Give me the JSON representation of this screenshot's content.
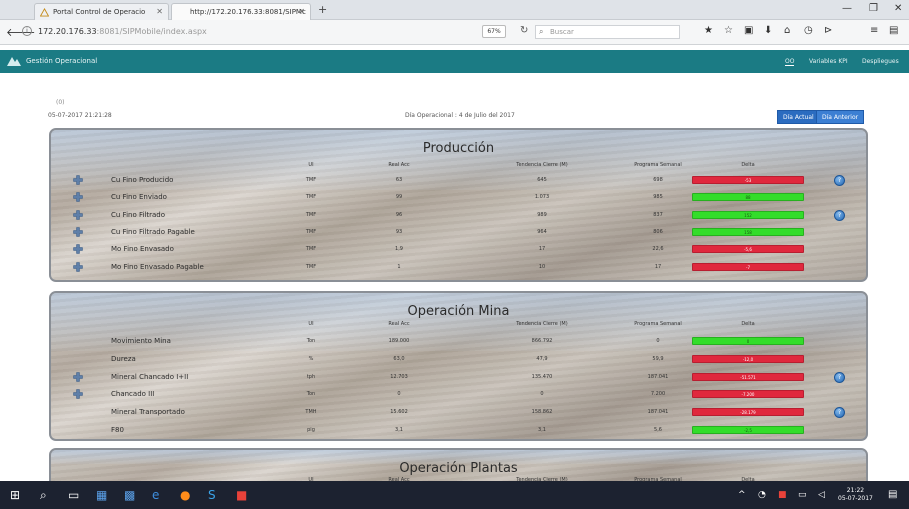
{
  "browser": {
    "tabs": [
      {
        "label": "Portal Control de Operacio",
        "active": false
      },
      {
        "label": "http://172.20.176.33:8081/SIPMc",
        "active": true
      }
    ],
    "url_host": "172.20.176.33",
    "url_rest": ":8081/SIPMobile/index.aspx",
    "zoom": "67%",
    "search_placeholder": "Buscar"
  },
  "app": {
    "title": "Gestión Operacional",
    "nav": [
      "OO",
      "Variables KPI",
      "Despliegues"
    ]
  },
  "meta": {
    "small": "(0)",
    "date": "05-07-2017 21:21:28",
    "center": "Día Operacional : 4 de Julio del 2017",
    "btn_actual": "Día Actual",
    "btn_anterior": "Día Anterior"
  },
  "columns": {
    "ui": "UI",
    "real": "Real Acc",
    "tendencia": "Tendencia Cierre (M)",
    "programa": "Programa Semanal",
    "delta": "Delta"
  },
  "colors": {
    "header": "#1b7b84",
    "delta_red": "#e0283d",
    "delta_green": "#33dd2a",
    "button_blue": "#2b6cc0"
  },
  "panels": [
    {
      "title": "Producción",
      "rows": [
        {
          "label": "Cu Fino Producido",
          "ui": "TMF",
          "real": "63",
          "tendencia": "645",
          "programa": "698",
          "delta": "-53",
          "status": "red",
          "icon": true,
          "info": true
        },
        {
          "label": "Cu Fino Enviado",
          "ui": "TMF",
          "real": "99",
          "tendencia": "1.073",
          "programa": "985",
          "delta": "88",
          "status": "green",
          "icon": true,
          "info": false
        },
        {
          "label": "Cu Fino Filtrado",
          "ui": "TMF",
          "real": "96",
          "tendencia": "989",
          "programa": "837",
          "delta": "152",
          "status": "green",
          "icon": true,
          "info": true
        },
        {
          "label": "Cu Fino Filtrado Pagable",
          "ui": "TMF",
          "real": "93",
          "tendencia": "964",
          "programa": "806",
          "delta": "158",
          "status": "green",
          "icon": true,
          "info": false
        },
        {
          "label": "Mo Fino Envasado",
          "ui": "TMF",
          "real": "1,9",
          "tendencia": "17",
          "programa": "22,6",
          "delta": "-5,6",
          "status": "red",
          "icon": true,
          "info": false
        },
        {
          "label": "Mo Fino Envasado Pagable",
          "ui": "TMF",
          "real": "1",
          "tendencia": "10",
          "programa": "17",
          "delta": "-7",
          "status": "red",
          "icon": true,
          "info": false
        }
      ]
    },
    {
      "title": "Operación Mina",
      "rows": [
        {
          "label": "Movimiento Mina",
          "ui": "Ton",
          "real": "189.000",
          "tendencia": "866.792",
          "programa": "0",
          "delta": "0",
          "status": "green",
          "icon": false,
          "info": false
        },
        {
          "label": "Dureza",
          "ui": "%",
          "real": "63,0",
          "tendencia": "47,9",
          "programa": "59,9",
          "delta": "-12,0",
          "status": "red",
          "icon": false,
          "info": false
        },
        {
          "label": "Mineral Chancado I+II",
          "ui": "tph",
          "real": "12.703",
          "tendencia": "135.470",
          "programa": "187.041",
          "delta": "-51.571",
          "status": "red",
          "icon": true,
          "info": true
        },
        {
          "label": "Chancado III",
          "ui": "Ton",
          "real": "0",
          "tendencia": "0",
          "programa": "7.200",
          "delta": "-7.200",
          "status": "red",
          "icon": true,
          "info": false
        },
        {
          "label": "Mineral Transportado",
          "ui": "TMH",
          "real": "15.602",
          "tendencia": "158.862",
          "programa": "187.041",
          "delta": "-28.179",
          "status": "red",
          "icon": false,
          "info": true
        },
        {
          "label": "F80",
          "ui": "pig",
          "real": "3,1",
          "tendencia": "3,1",
          "programa": "5,6",
          "delta": "-2,5",
          "status": "green",
          "icon": false,
          "info": false
        }
      ]
    },
    {
      "title": "Operación Plantas",
      "rows": []
    }
  ],
  "taskbar": {
    "time": "21:22",
    "date": "05-07-2017"
  }
}
